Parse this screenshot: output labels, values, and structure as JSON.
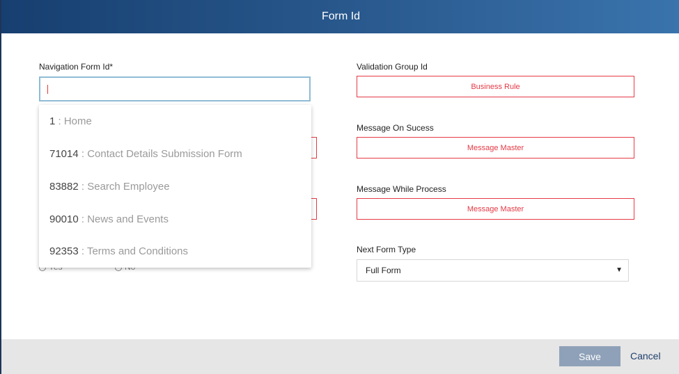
{
  "header": {
    "title": "Form Id"
  },
  "left": {
    "nav_form_label": "Navigation Form Id*",
    "nav_form_value": "",
    "radio_yes": "Yes",
    "radio_no": "No"
  },
  "dropdown": {
    "items": [
      {
        "id": "1",
        "name": " : Home"
      },
      {
        "id": "71014",
        "name": " : Contact Details Submission Form"
      },
      {
        "id": "83882",
        "name": " : Search Employee"
      },
      {
        "id": "90010",
        "name": " : News and Events"
      },
      {
        "id": "92353",
        "name": " : Terms and Conditions"
      }
    ]
  },
  "right": {
    "validation_label": "Validation Group Id",
    "validation_button": "Business Rule",
    "success_label": "Message On Sucess",
    "success_button": "Message Master",
    "process_label": "Message While Process",
    "process_button": "Message Master",
    "next_form_label": "Next Form Type",
    "next_form_value": "Full Form"
  },
  "footer": {
    "save_label": "Save",
    "cancel_label": "Cancel"
  },
  "colors": {
    "header": "#173f70",
    "accent_red": "#e53945",
    "save_disabled": "#8ea1b8",
    "link": "#1f3f6d"
  },
  "icons": {
    "select_arrow": "triangle-down-icon"
  }
}
